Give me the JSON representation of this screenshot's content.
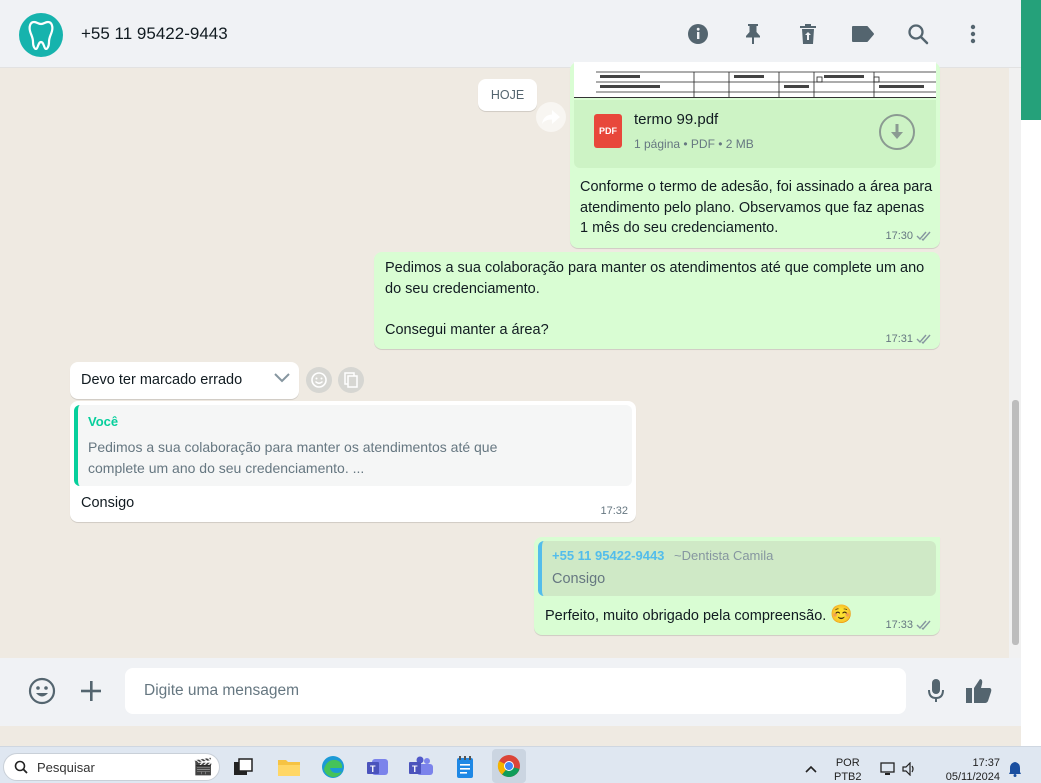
{
  "header": {
    "contact_name": "+55 11 95422-9443",
    "icons": [
      "info-icon",
      "pin-icon",
      "delete-icon",
      "label-icon",
      "search-icon",
      "menu-icon"
    ]
  },
  "chat": {
    "date_label": "HOJE",
    "pdf_message": {
      "file_name": "termo 99.pdf",
      "file_info": "1 página • PDF • 2 MB",
      "badge": "PDF",
      "text": "Conforme o termo de adesão, foi assinado a área para atendimento pelo plano. Observamos que faz apenas 1 mês do seu credenciamento.",
      "time": "17:30"
    },
    "out_message_2": {
      "line1": "Pedimos a sua colaboração para manter os atendimentos até que complete um ano do seu credenciamento.",
      "line2": "Consegui manter a área?",
      "time": "17:31"
    },
    "in_message_1": {
      "text": "Devo ter marcado errado"
    },
    "in_message_2": {
      "quote_author": "Você",
      "quote_text": "Pedimos a sua colaboração para manter os atendimentos até que complete um ano do seu credenciamento. ...",
      "text": "Consigo",
      "time": "17:32"
    },
    "out_message_3": {
      "quote_author": "+55 11 95422-9443",
      "quote_alias": "~Dentista Camila",
      "quote_text": "Consigo",
      "text": "Perfeito, muito obrigado pela compreensão.",
      "emoji": "☺️",
      "time": "17:33"
    }
  },
  "input": {
    "placeholder": "Digite uma mensagem"
  },
  "taskbar": {
    "search_label": "Pesquisar",
    "lang_1": "POR",
    "lang_2": "PTB2",
    "time": "17:37",
    "date": "05/11/2024"
  },
  "colors": {
    "outgoing_bubble": "#d9fdd3",
    "incoming_bubble": "#ffffff",
    "accent_green": "#25a17a",
    "quote_teal": "#06cf9c",
    "quote_blue": "#53bdeb",
    "read_ticks": "#8696a0"
  }
}
